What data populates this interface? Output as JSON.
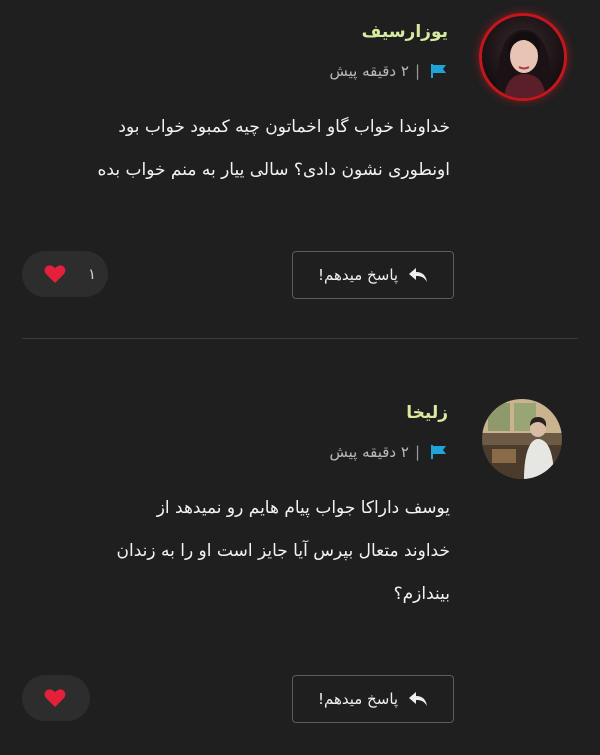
{
  "comments": [
    {
      "username": "یوزارسیف",
      "time": "۲ دقیقه پیش",
      "separator": "|",
      "body_line1": "خداوندا خواب گاو اخماتون چیه کمبود خواب بود",
      "body_line2": "اونطوری نشون دادی؟ سالی ییار به منم خواب بده",
      "reply_label": "پاسخ میدهم!",
      "like_count": "۱"
    },
    {
      "username": "زلیخا",
      "time": "۲ دقیقه پیش",
      "separator": "|",
      "body_line1": "یوسف داراکا جواب پیام هایم رو نمیدهد از",
      "body_line2": "خداوند متعال بپرس آیا جایز است او را به زندان",
      "body_line3": "بیندازم؟",
      "reply_label": "پاسخ میدهم!",
      "like_count": ""
    }
  ],
  "colors": {
    "background": "#1f1f20",
    "username": "#d8ea9e",
    "flag": "#1fa3d8",
    "heart": "#e3213a",
    "avatar_ring": "#c4161c"
  },
  "icons": {
    "flag": "flag-icon",
    "reply": "reply-arrow-icon",
    "heart": "heart-icon"
  }
}
